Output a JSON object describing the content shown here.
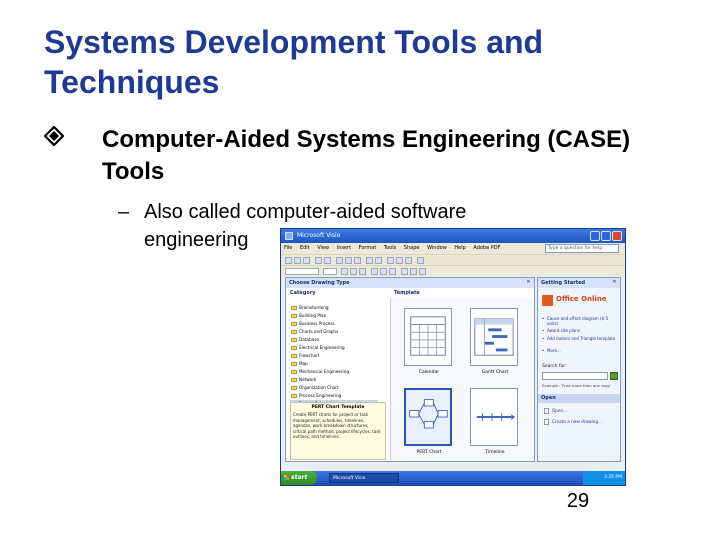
{
  "slide": {
    "title": "Systems Development Tools and Techniques",
    "bullet": "Computer-Aided Systems Engineering (CASE) Tools",
    "subbullet": "Also called computer-aided software engineering",
    "page_number": "29",
    "colors": {
      "title": "#1f3a93",
      "text": "#000000"
    }
  },
  "screenshot": {
    "window_title": "Microsoft Visio",
    "menu": [
      "File",
      "Edit",
      "View",
      "Insert",
      "Format",
      "Tools",
      "Shape",
      "Window",
      "Help",
      "Adobe PDF"
    ],
    "help_placeholder": "Type a question for help",
    "drawing_type_pane": {
      "header": "Choose Drawing Type",
      "category_label": "Category",
      "template_label": "Template",
      "categories": [
        "Brainstorming",
        "Building Plan",
        "Business Process",
        "Charts and Graphs",
        "Database",
        "Electrical Engineering",
        "Flowchart",
        "Map",
        "Mechanical Engineering",
        "Network",
        "Organization Chart",
        "Process Engineering",
        "Project Schedule"
      ],
      "selected_category": "Project Schedule",
      "templates": [
        "Calendar",
        "Gantt Chart",
        "PERT Chart",
        "Timeline"
      ],
      "selected_template": "PERT Chart",
      "description_title": "PERT Chart Template",
      "description_text": "Create PERT charts for project or task management, schedules, timelines, agendas, work breakdown structures, critical path method, project lifecycles, task outlines, and timelines."
    },
    "getting_started_pane": {
      "header": "Getting Started",
      "brand": "Office Online",
      "links": [
        "Cause and effect diagram (6-5 units)",
        "Award site plans",
        "Add meters and Triangle template",
        "More..."
      ],
      "search_label": "Search for:",
      "search_example": "Example: 'Print more than one copy'",
      "open_section": "Open",
      "open_items": [
        "Open...",
        "Create a new drawing..."
      ]
    },
    "taskbar": {
      "start_label": "start",
      "task_item": "Microsoft Visio",
      "clock": "3:25 PM"
    }
  }
}
